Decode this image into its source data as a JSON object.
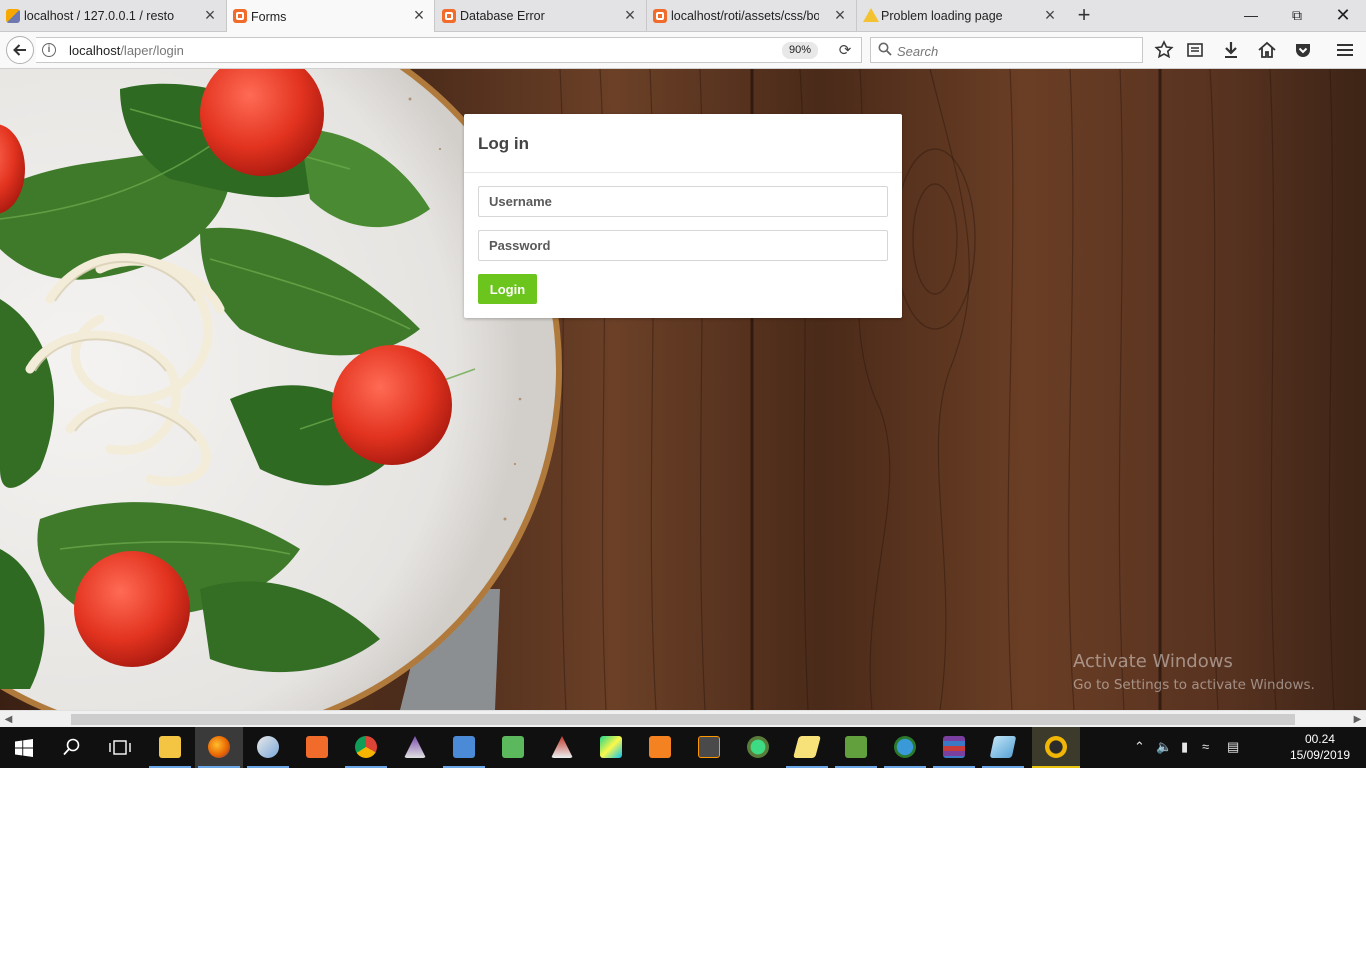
{
  "browser": {
    "tabs": [
      {
        "title": "localhost / 127.0.0.1 / resto /",
        "favicon": "phpmyadmin-icon",
        "active": false
      },
      {
        "title": "Forms",
        "favicon": "xampp-icon",
        "active": true
      },
      {
        "title": "Database Error",
        "favicon": "xampp-icon",
        "active": false
      },
      {
        "title": "localhost/roti/assets/css/bo",
        "favicon": "xampp-icon",
        "active": false
      },
      {
        "title": "Problem loading page",
        "favicon": "warning-icon",
        "active": false
      }
    ],
    "url_host": "localhost",
    "url_path": "/laper/login",
    "zoom": "90%",
    "search_placeholder": "Search"
  },
  "login": {
    "title": "Log in",
    "username_placeholder": "Username",
    "password_placeholder": "Password",
    "button_label": "Login",
    "button_color": "#6bc51c"
  },
  "watermark": {
    "line1": "Activate Windows",
    "line2": "Go to Settings to activate Windows."
  },
  "taskbar": {
    "time": "00.24",
    "date": "15/09/2019"
  }
}
